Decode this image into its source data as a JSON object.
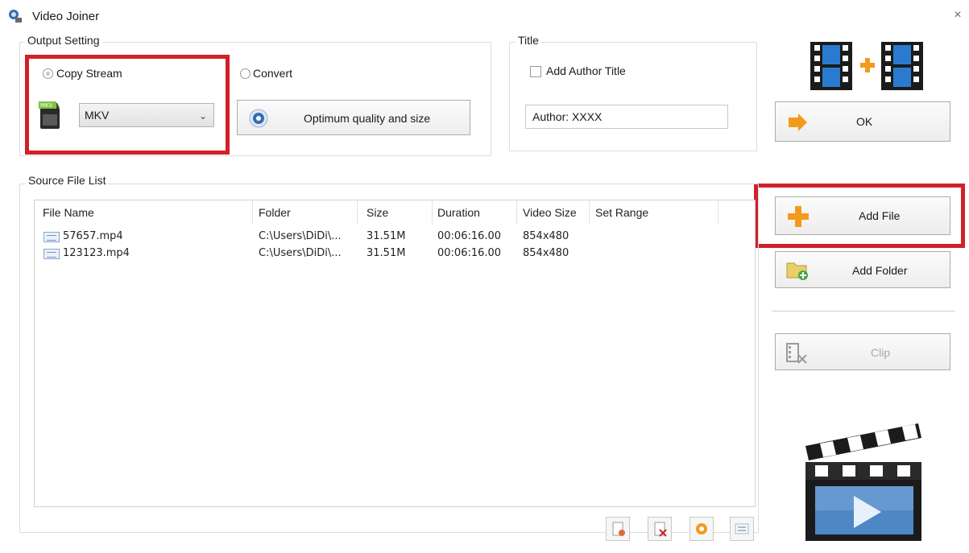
{
  "window": {
    "title": "Video Joiner",
    "close_glyph": "×"
  },
  "output_setting": {
    "group_label": "Output Setting",
    "copy_stream_label": "Copy Stream",
    "copy_stream_selected": true,
    "format_value": "MKV",
    "convert_label": "Convert",
    "convert_selected": false,
    "quality_button_label": "Optimum quality and size"
  },
  "title_group": {
    "group_label": "Title",
    "add_author_title_label": "Add Author Title",
    "add_author_title_checked": false,
    "author_value": "Author: XXXX"
  },
  "actions": {
    "ok_label": "OK",
    "add_file_label": "Add File",
    "add_folder_label": "Add Folder",
    "clip_label": "Clip"
  },
  "source_list": {
    "group_label": "Source File List",
    "columns": [
      "File Name",
      "Folder",
      "Size",
      "Duration",
      "Video Size",
      "Set Range"
    ],
    "rows": [
      {
        "file_name": "57657.mp4",
        "folder": "C:\\Users\\DiDi\\...",
        "size": "31.51M",
        "duration": "00:06:16.00",
        "video_size": "854x480",
        "set_range": ""
      },
      {
        "file_name": "123123.mp4",
        "folder": "C:\\Users\\DiDi\\...",
        "size": "31.51M",
        "duration": "00:06:16.00",
        "video_size": "854x480",
        "set_range": ""
      }
    ]
  },
  "colors": {
    "highlight": "#d0202a",
    "accent_orange": "#f39a1c",
    "film_blue": "#1f5fa8"
  }
}
